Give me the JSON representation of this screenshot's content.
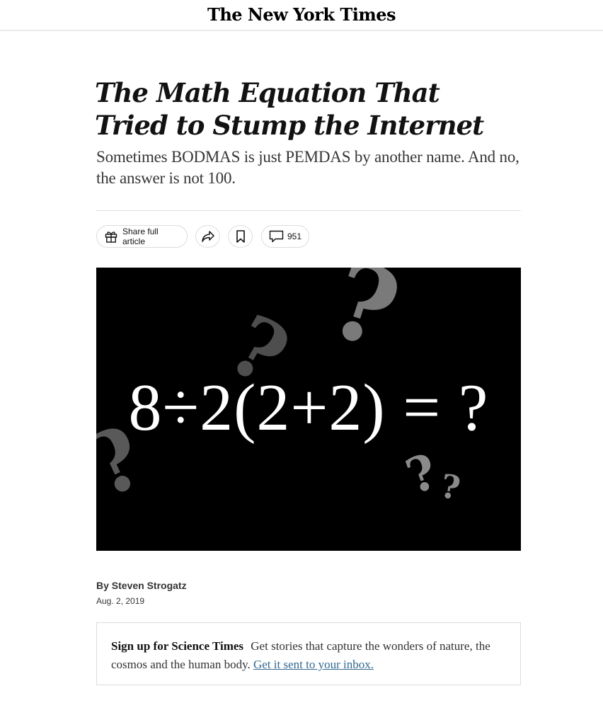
{
  "masthead": {
    "logo": "The New York Times"
  },
  "article": {
    "headline": "The Math Equation That Tried to Stump the Internet",
    "summary": "Sometimes BODMAS is just PEMDAS by another name. And no, the answer is not 100.",
    "byline_prefix": "By",
    "author": "Steven Strogatz",
    "date": "Aug. 2, 2019"
  },
  "toolbar": {
    "share_full_label": "Share full article",
    "comment_count": "951",
    "icons": [
      "gift-icon",
      "share-icon",
      "bookmark-icon",
      "comment-icon"
    ]
  },
  "hero": {
    "equation": "8÷2(2+2) = ?",
    "question_marks": [
      "?",
      "?",
      "?",
      "?",
      "?"
    ]
  },
  "newsletter": {
    "title": "Sign up for Science Times",
    "body": "Get stories that capture the wonders of nature, the cosmos and the human body.",
    "link": "Get it sent to your inbox."
  },
  "colors": {
    "link": "#326891",
    "text": "#121212",
    "hero_bg": "#000000"
  }
}
